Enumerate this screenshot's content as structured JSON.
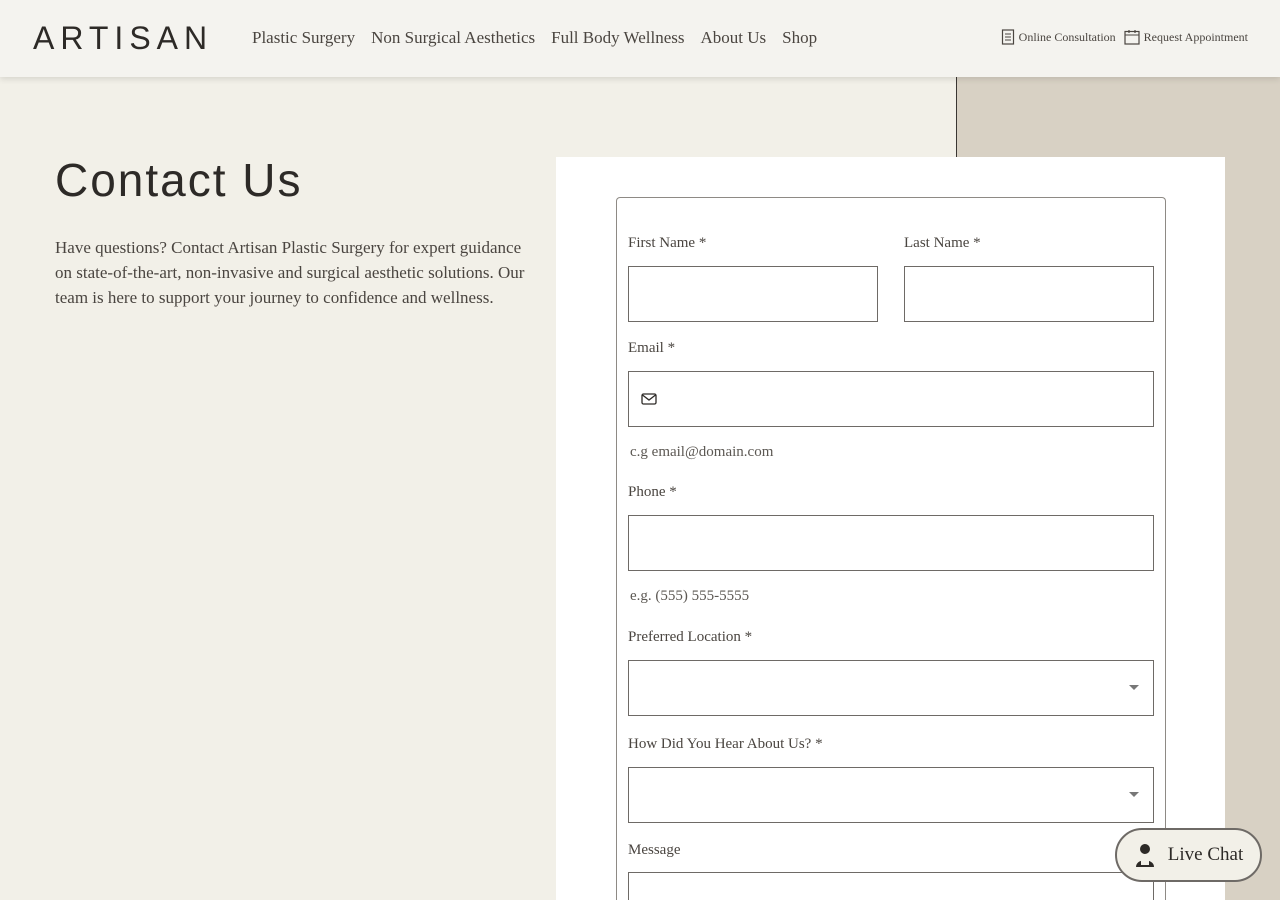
{
  "header": {
    "logo": "ARTISAN",
    "nav": [
      "Plastic Surgery",
      "Non Surgical Aesthetics",
      "Full Body Wellness",
      "About Us",
      "Shop"
    ],
    "online_consultation": "Online Consultation",
    "request_appointment": "Request Appointment"
  },
  "page": {
    "title": "Contact Us",
    "intro": "Have questions? Contact Artisan Plastic Surgery for expert guidance on state-of-the-art, non-invasive and surgical aesthetic solutions. Our team is here to support your journey to confidence and wellness."
  },
  "form": {
    "first_name_label": "First Name *",
    "last_name_label": "Last Name *",
    "email_label": "Email *",
    "email_hint": "c.g email@domain.com",
    "phone_label": "Phone *",
    "phone_hint": "e.g. (555) 555-5555",
    "location_label": "Preferred Location *",
    "hear_label": "How Did You Hear About Us? *",
    "message_label": "Message"
  },
  "chat": {
    "label": "Live Chat"
  },
  "icons": {
    "consultation": "document-icon",
    "appointment": "calendar-icon",
    "email": "mail-icon",
    "chat": "agent-icon"
  }
}
